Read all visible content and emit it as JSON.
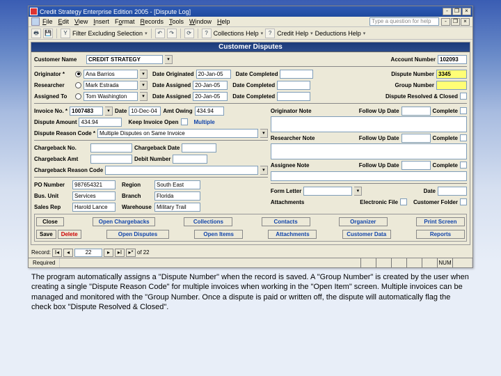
{
  "window": {
    "title": "Credit Strategy Enterprise Edition 2005 - [Dispute Log]"
  },
  "menus": {
    "file": "File",
    "edit": "Edit",
    "view": "View",
    "insert": "Insert",
    "format": "Format",
    "records": "Records",
    "tools": "Tools",
    "window": "Window",
    "help": "Help",
    "ask": "Type a question for help"
  },
  "toolbar": {
    "filter": "Filter Excluding Selection",
    "collections": "Collections Help",
    "credit": "Credit Help",
    "deductions": "Deductions Help"
  },
  "subtitle": "Customer Disputes",
  "hdr": {
    "cust_lbl": "Customer Name",
    "cust": "CREDIT STRATEGY",
    "acct_lbl": "Account Number",
    "acct": "102093"
  },
  "orig": {
    "originator_lbl": "Originator *",
    "researcher_lbl": "Researcher",
    "assigned_lbl": "Assigned To",
    "originator": "Ana Barrios",
    "researcher": "Mark Estrada",
    "assigned": "Tom Washington",
    "dateorig_lbl": "Date Originated",
    "dateassn_lbl": "Date Assigned",
    "dateassn2_lbl": "Date Assigned",
    "dateorig": "20-Jan-05",
    "dateassn": "20-Jan-05",
    "dateassn2": "20-Jan-05",
    "datecomp_lbl": "Date Completed",
    "dispnum_lbl": "Dispute Number",
    "dispnum": "3345",
    "groupnum_lbl": "Group Number",
    "resolved_lbl": "Dispute Resolved & Closed"
  },
  "inv": {
    "invno_lbl": "Invoice No. *",
    "invno": "1007483",
    "date_lbl": "Date",
    "date": "10-Dec-04",
    "amtowe_lbl": "Amt Owing",
    "amtowe": "434.94",
    "dispamt_lbl": "Dispute Amount",
    "dispamt": "434.94",
    "keepopen_lbl": "Keep Invoice Open",
    "multiple": "Multiple",
    "reason_lbl": "Dispute Reason Code *",
    "reason": "Multiple Disputes on Same Invoice"
  },
  "cb": {
    "no_lbl": "Chargeback No.",
    "date_lbl": "Chargeback Date",
    "amt_lbl": "Chargeback Amt",
    "debit_lbl": "Debit Number",
    "reason_lbl": "Chargeback Reason Code"
  },
  "misc": {
    "po_lbl": "PO Number",
    "po": "987654321",
    "region_lbl": "Region",
    "region": "South East",
    "bu_lbl": "Bus. Unit",
    "bu": "Services",
    "branch_lbl": "Branch",
    "branch": "Florida",
    "rep_lbl": "Sales Rep",
    "rep": "Harold Lance",
    "wh_lbl": "Warehouse",
    "wh": "Military Trail"
  },
  "notes": {
    "orignote_lbl": "Originator Note",
    "resnote_lbl": "Researcher Note",
    "assnote_lbl": "Assignee Note",
    "fud_lbl": "Follow Up Date",
    "complete_lbl": "Complete",
    "form_lbl": "Form Letter",
    "date_lbl": "Date",
    "attach_lbl": "Attachments",
    "efile_lbl": "Electronic File",
    "cfolder_lbl": "Customer Folder"
  },
  "actions": {
    "close": "Close",
    "save": "Save",
    "delete": "Delete",
    "opencb": "Open Chargebacks",
    "opendisp": "Open Disputes",
    "collections": "Collections",
    "openitems": "Open Items",
    "contacts": "Contacts",
    "attachments": "Attachments",
    "organizer": "Organizer",
    "custdata": "Customer Data",
    "print": "Print Screen",
    "reports": "Reports"
  },
  "nav": {
    "record_lbl": "Record:",
    "pos": "22",
    "of": "of",
    "total": "22"
  },
  "status": {
    "left": "Required",
    "num": "NUM"
  },
  "caption": "The program automatically assigns a \"Dispute Number\" when the record is saved. A \"Group Number\" is created by the user when creating a single \"Dispute Reason Code\" for multiple invoices when working in the \"Open Item\" screen. Multiple invoices can be managed and monitored with the \"Group Number. Once a dispute is paid or written off, the dispute will automatically flag the check box \"Dispute Resolved & Closed\"."
}
